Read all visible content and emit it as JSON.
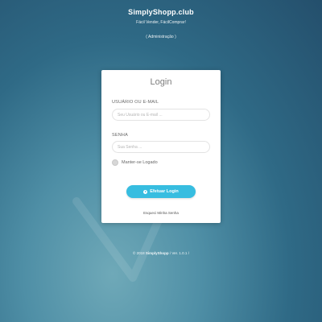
{
  "header": {
    "brand": "SimplyShopp.club",
    "tagline": "Fácil Vender, FácilComprar!",
    "admin_link": "( Administração )"
  },
  "login": {
    "title": "Login",
    "user_label": "USUÁRIO OU E-MAIL",
    "user_placeholder": "Seu Usuário ou E-mail ...",
    "password_label": "SENHA",
    "password_placeholder": "Sua Senha ...",
    "remember_label": "Manter-se Logado",
    "submit_label": "Efetuar Login",
    "forgot_label": "Esqueci Minha Senha"
  },
  "footer": {
    "prefix": "© 2018",
    "brand": "SimplyShopp",
    "version": "/ Ver. 1.0.1 /"
  },
  "colors": {
    "accent": "#37bde0",
    "background": "#2f6a86"
  },
  "icons": [
    "play-circle-icon",
    "checkmark-background-icon"
  ]
}
